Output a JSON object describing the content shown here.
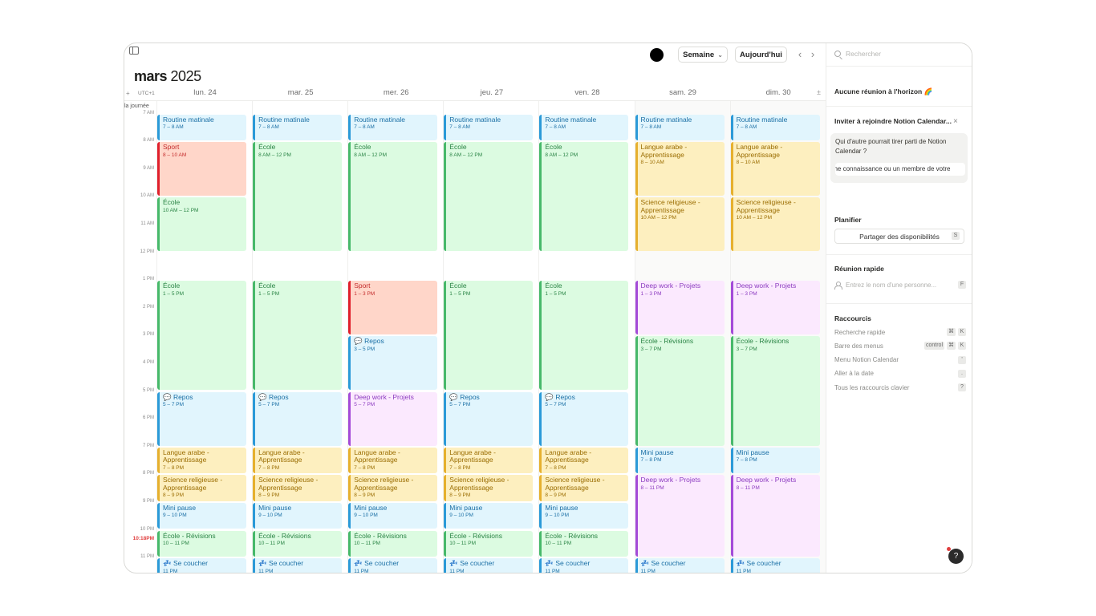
{
  "header": {
    "view_label": "Semaine",
    "today_label": "Aujourd'hui",
    "month_bold": "mars",
    "year": "2025",
    "tz_label": "UTC+1",
    "allday_label": "la journée",
    "prev_icon": "chevron-left-icon",
    "next_icon": "chevron-right-icon"
  },
  "days": [
    {
      "label": "lun. 24"
    },
    {
      "label": "mar. 25"
    },
    {
      "label": "mer. 26"
    },
    {
      "label": "jeu. 27"
    },
    {
      "label": "ven. 28"
    },
    {
      "label": "sam. 29"
    },
    {
      "label": "dim. 30"
    }
  ],
  "hours": [
    "7 AM",
    "8 AM",
    "9 AM",
    "10 AM",
    "11 AM",
    "12 PM",
    "1 PM",
    "2 PM",
    "3 PM",
    "4 PM",
    "5 PM",
    "6 PM",
    "7 PM",
    "8 PM",
    "9 PM",
    "10 PM",
    "11 PM"
  ],
  "now_label": "10:18PM",
  "events": [
    {
      "day": 0,
      "start": 7,
      "end": 8,
      "title": "Routine matinale",
      "time": "7 – 8 AM",
      "color": "blue"
    },
    {
      "day": 0,
      "start": 8,
      "end": 10,
      "title": "Sport",
      "time": "8 – 10 AM",
      "color": "red"
    },
    {
      "day": 0,
      "start": 10,
      "end": 12,
      "title": "École",
      "time": "10 AM – 12 PM",
      "color": "green"
    },
    {
      "day": 0,
      "start": 13,
      "end": 17,
      "title": "École",
      "time": "1 – 5 PM",
      "color": "green"
    },
    {
      "day": 0,
      "start": 17,
      "end": 19,
      "title": "💬 Repos",
      "time": "5 – 7 PM",
      "color": "blue"
    },
    {
      "day": 0,
      "start": 19,
      "end": 20,
      "title": "Langue arabe - Apprentissage",
      "time": "7 – 8 PM",
      "color": "yellow"
    },
    {
      "day": 0,
      "start": 20,
      "end": 21,
      "title": "Science religieuse - Apprentissage",
      "time": "8 – 9 PM",
      "color": "yellow"
    },
    {
      "day": 0,
      "start": 21,
      "end": 22,
      "title": "Mini pause",
      "time": "9 – 10 PM",
      "color": "blue"
    },
    {
      "day": 0,
      "start": 22,
      "end": 23,
      "title": "École - Révisions",
      "time": "10 – 11 PM",
      "color": "green"
    },
    {
      "day": 0,
      "start": 23,
      "end": 24,
      "title": "💤 Se coucher",
      "time": "11 PM",
      "color": "blue"
    },
    {
      "day": 1,
      "start": 7,
      "end": 8,
      "title": "Routine matinale",
      "time": "7 – 8 AM",
      "color": "blue"
    },
    {
      "day": 1,
      "start": 8,
      "end": 12,
      "title": "École",
      "time": "8 AM – 12 PM",
      "color": "green"
    },
    {
      "day": 1,
      "start": 13,
      "end": 17,
      "title": "École",
      "time": "1 – 5 PM",
      "color": "green"
    },
    {
      "day": 1,
      "start": 17,
      "end": 19,
      "title": "💬 Repos",
      "time": "5 – 7 PM",
      "color": "blue"
    },
    {
      "day": 1,
      "start": 19,
      "end": 20,
      "title": "Langue arabe - Apprentissage",
      "time": "7 – 8 PM",
      "color": "yellow"
    },
    {
      "day": 1,
      "start": 20,
      "end": 21,
      "title": "Science religieuse - Apprentissage",
      "time": "8 – 9 PM",
      "color": "yellow"
    },
    {
      "day": 1,
      "start": 21,
      "end": 22,
      "title": "Mini pause",
      "time": "9 – 10 PM",
      "color": "blue"
    },
    {
      "day": 1,
      "start": 22,
      "end": 23,
      "title": "École - Révisions",
      "time": "10 – 11 PM",
      "color": "green"
    },
    {
      "day": 1,
      "start": 23,
      "end": 24,
      "title": "💤 Se coucher",
      "time": "11 PM",
      "color": "blue"
    },
    {
      "day": 2,
      "start": 7,
      "end": 8,
      "title": "Routine matinale",
      "time": "7 – 8 AM",
      "color": "blue"
    },
    {
      "day": 2,
      "start": 8,
      "end": 12,
      "title": "École",
      "time": "8 AM – 12 PM",
      "color": "green"
    },
    {
      "day": 2,
      "start": 13,
      "end": 15,
      "title": "Sport",
      "time": "1 – 3 PM",
      "color": "red"
    },
    {
      "day": 2,
      "start": 15,
      "end": 17,
      "title": "💬 Repos",
      "time": "3 – 5 PM",
      "color": "blue"
    },
    {
      "day": 2,
      "start": 17,
      "end": 19,
      "title": "Deep work - Projets",
      "time": "5 – 7 PM",
      "color": "purple"
    },
    {
      "day": 2,
      "start": 19,
      "end": 20,
      "title": "Langue arabe - Apprentissage",
      "time": "7 – 8 PM",
      "color": "yellow"
    },
    {
      "day": 2,
      "start": 20,
      "end": 21,
      "title": "Science religieuse - Apprentissage",
      "time": "8 – 9 PM",
      "color": "yellow"
    },
    {
      "day": 2,
      "start": 21,
      "end": 22,
      "title": "Mini pause",
      "time": "9 – 10 PM",
      "color": "blue"
    },
    {
      "day": 2,
      "start": 22,
      "end": 23,
      "title": "École - Révisions",
      "time": "10 – 11 PM",
      "color": "green"
    },
    {
      "day": 2,
      "start": 23,
      "end": 24,
      "title": "💤 Se coucher",
      "time": "11 PM",
      "color": "blue"
    },
    {
      "day": 3,
      "start": 7,
      "end": 8,
      "title": "Routine matinale",
      "time": "7 – 8 AM",
      "color": "blue"
    },
    {
      "day": 3,
      "start": 8,
      "end": 12,
      "title": "École",
      "time": "8 AM – 12 PM",
      "color": "green"
    },
    {
      "day": 3,
      "start": 13,
      "end": 17,
      "title": "École",
      "time": "1 – 5 PM",
      "color": "green"
    },
    {
      "day": 3,
      "start": 17,
      "end": 19,
      "title": "💬 Repos",
      "time": "5 – 7 PM",
      "color": "blue"
    },
    {
      "day": 3,
      "start": 19,
      "end": 20,
      "title": "Langue arabe - Apprentissage",
      "time": "7 – 8 PM",
      "color": "yellow"
    },
    {
      "day": 3,
      "start": 20,
      "end": 21,
      "title": "Science religieuse - Apprentissage",
      "time": "8 – 9 PM",
      "color": "yellow"
    },
    {
      "day": 3,
      "start": 21,
      "end": 22,
      "title": "Mini pause",
      "time": "9 – 10 PM",
      "color": "blue"
    },
    {
      "day": 3,
      "start": 22,
      "end": 23,
      "title": "École - Révisions",
      "time": "10 – 11 PM",
      "color": "green"
    },
    {
      "day": 3,
      "start": 23,
      "end": 24,
      "title": "💤 Se coucher",
      "time": "11 PM",
      "color": "blue"
    },
    {
      "day": 4,
      "start": 7,
      "end": 8,
      "title": "Routine matinale",
      "time": "7 – 8 AM",
      "color": "blue"
    },
    {
      "day": 4,
      "start": 8,
      "end": 12,
      "title": "École",
      "time": "8 AM – 12 PM",
      "color": "green"
    },
    {
      "day": 4,
      "start": 13,
      "end": 17,
      "title": "École",
      "time": "1 – 5 PM",
      "color": "green"
    },
    {
      "day": 4,
      "start": 17,
      "end": 19,
      "title": "💬 Repos",
      "time": "5 – 7 PM",
      "color": "blue"
    },
    {
      "day": 4,
      "start": 19,
      "end": 20,
      "title": "Langue arabe - Apprentissage",
      "time": "7 – 8 PM",
      "color": "yellow"
    },
    {
      "day": 4,
      "start": 20,
      "end": 21,
      "title": "Science religieuse - Apprentissage",
      "time": "8 – 9 PM",
      "color": "yellow"
    },
    {
      "day": 4,
      "start": 21,
      "end": 22,
      "title": "Mini pause",
      "time": "9 – 10 PM",
      "color": "blue"
    },
    {
      "day": 4,
      "start": 22,
      "end": 23,
      "title": "École - Révisions",
      "time": "10 – 11 PM",
      "color": "green"
    },
    {
      "day": 4,
      "start": 23,
      "end": 24,
      "title": "💤 Se coucher",
      "time": "11 PM",
      "color": "blue"
    },
    {
      "day": 5,
      "start": 7,
      "end": 8,
      "title": "Routine matinale",
      "time": "7 – 8 AM",
      "color": "blue"
    },
    {
      "day": 5,
      "start": 8,
      "end": 10,
      "title": "Langue arabe - Apprentissage",
      "time": "8 – 10 AM",
      "color": "yellow"
    },
    {
      "day": 5,
      "start": 10,
      "end": 12,
      "title": "Science religieuse - Apprentissage",
      "time": "10 AM – 12 PM",
      "color": "yellow"
    },
    {
      "day": 5,
      "start": 13,
      "end": 15,
      "title": "Deep work - Projets",
      "time": "1 – 3 PM",
      "color": "purple"
    },
    {
      "day": 5,
      "start": 15,
      "end": 19,
      "title": "École - Révisions",
      "time": "3 – 7 PM",
      "color": "green"
    },
    {
      "day": 5,
      "start": 19,
      "end": 20,
      "title": "Mini pause",
      "time": "7 – 8 PM",
      "color": "blue"
    },
    {
      "day": 5,
      "start": 20,
      "end": 23,
      "title": "Deep work - Projets",
      "time": "8 – 11 PM",
      "color": "purple"
    },
    {
      "day": 5,
      "start": 23,
      "end": 24,
      "title": "💤 Se coucher",
      "time": "11 PM",
      "color": "blue"
    },
    {
      "day": 6,
      "start": 7,
      "end": 8,
      "title": "Routine matinale",
      "time": "7 – 8 AM",
      "color": "blue"
    },
    {
      "day": 6,
      "start": 8,
      "end": 10,
      "title": "Langue arabe - Apprentissage",
      "time": "8 – 10 AM",
      "color": "yellow"
    },
    {
      "day": 6,
      "start": 10,
      "end": 12,
      "title": "Science religieuse - Apprentissage",
      "time": "10 AM – 12 PM",
      "color": "yellow"
    },
    {
      "day": 6,
      "start": 13,
      "end": 15,
      "title": "Deep work - Projets",
      "time": "1 – 3 PM",
      "color": "purple"
    },
    {
      "day": 6,
      "start": 15,
      "end": 19,
      "title": "École - Révisions",
      "time": "3 – 7 PM",
      "color": "green"
    },
    {
      "day": 6,
      "start": 19,
      "end": 20,
      "title": "Mini pause",
      "time": "7 – 8 PM",
      "color": "blue"
    },
    {
      "day": 6,
      "start": 20,
      "end": 23,
      "title": "Deep work - Projets",
      "time": "8 – 11 PM",
      "color": "purple"
    },
    {
      "day": 6,
      "start": 23,
      "end": 24,
      "title": "💤 Se coucher",
      "time": "11 PM",
      "color": "blue"
    }
  ],
  "side": {
    "search_placeholder": "Rechercher",
    "no_meeting": "Aucune réunion à l'horizon 🌈",
    "invite_title": "Inviter à rejoindre Notion Calendar...",
    "invite_question": "Qui d'autre pourrait tirer parti de Notion Calendar ?",
    "invite_input": "une connaissance ou un membre de votre",
    "plan_title": "Planifier",
    "share_label": "Partager des disponibilités",
    "share_key": "S",
    "quick_title": "Réunion rapide",
    "quick_placeholder": "Entrez le nom d'une personne...",
    "quick_key": "F",
    "shortcuts_title": "Raccourcis",
    "shortcuts": [
      {
        "label": "Recherche rapide",
        "keys": [
          "⌘",
          "K"
        ]
      },
      {
        "label": "Barre des menus",
        "keys": [
          "control",
          "⌘",
          "K"
        ]
      },
      {
        "label": "Menu Notion Calendar",
        "keys": [
          "'"
        ]
      },
      {
        "label": "Aller à la date",
        "keys": [
          "."
        ]
      },
      {
        "label": "Tous les raccourcis clavier",
        "keys": [
          "?"
        ]
      }
    ],
    "help_label": "?"
  }
}
